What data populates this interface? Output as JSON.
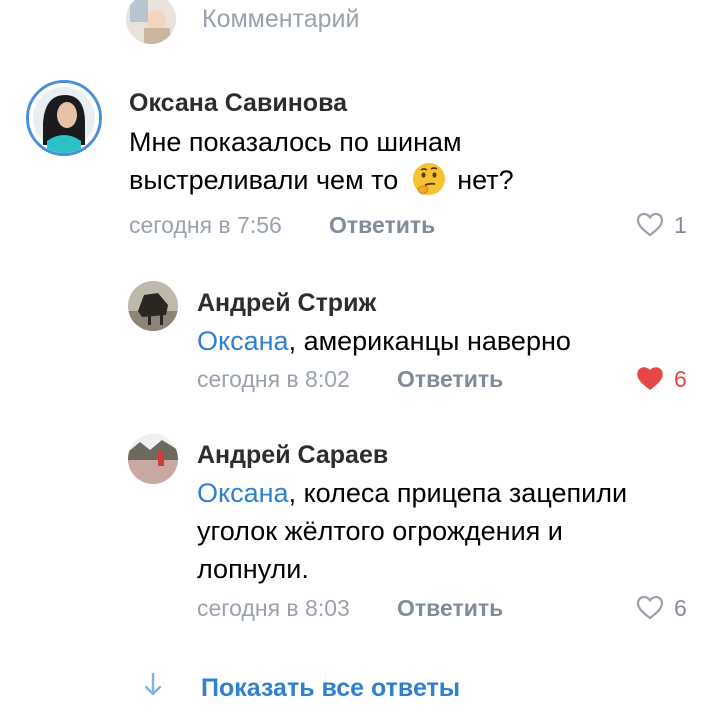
{
  "composer": {
    "placeholder": "Комментарий"
  },
  "comments": [
    {
      "author": "Оксана Савинова",
      "text_line1": "Мне показалось по шинам",
      "text_line2": "выстреливали чем то",
      "emoji": "🤔",
      "text_line2_end": "нет?",
      "time": "сегодня в 7:56",
      "reply_label": "Ответить",
      "likes": "1",
      "liked": false
    },
    {
      "author": "Андрей Стриж",
      "mention": "Оксана",
      "text": ", американцы наверно",
      "time": "сегодня в 8:02",
      "reply_label": "Ответить",
      "likes": "6",
      "liked": true
    },
    {
      "author": "Андрей Сараев",
      "mention": "Оксана",
      "text_line1": ", колеса прицепа зацепили",
      "text_line2": "уголок жёлтого огрождения и",
      "text_line3": "лопнули.",
      "time": "сегодня в 8:03",
      "reply_label": "Ответить",
      "likes": "6",
      "liked": false
    }
  ],
  "footer": {
    "show_all_label": "Показать все ответы",
    "arrow_icon": "arrow-down-icon"
  },
  "colors": {
    "link": "#2f80d1",
    "meta": "#99a2ad",
    "like_active": "#e64646",
    "avatar_ring": "#4a90d9"
  }
}
